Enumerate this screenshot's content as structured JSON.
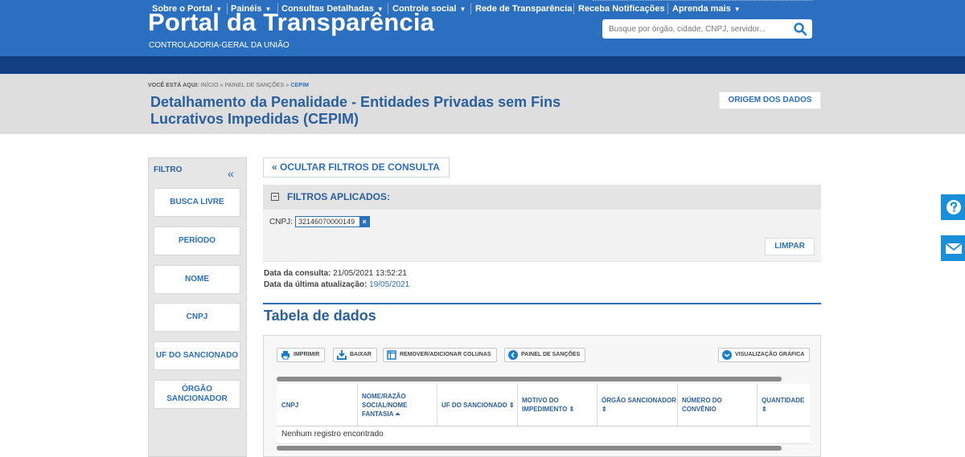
{
  "header": {
    "title": "Portal da Transparência",
    "subtitle": "CONTROLADORIA-GERAL DA UNIÃO",
    "search_placeholder": "Busque por órgão, cidade, CNPJ, servidor..."
  },
  "nav": {
    "items": [
      {
        "label": "Sobre o Portal",
        "dropdown": true
      },
      {
        "label": "Painéis",
        "dropdown": true
      },
      {
        "label": "Consultas Detalhadas",
        "dropdown": true
      },
      {
        "label": "Controle social",
        "dropdown": true
      },
      {
        "label": "Rede de Transparência",
        "dropdown": false
      },
      {
        "label": "Receba Notificações",
        "dropdown": false
      },
      {
        "label": "Aprenda mais",
        "dropdown": true
      }
    ]
  },
  "breadcrumb": {
    "label": "VOCÊ ESTÁ AQUI:",
    "items": [
      "INÍCIO",
      "PAINEL DE SANÇÕES",
      "CEPIM"
    ],
    "separator": "»"
  },
  "page": {
    "title": "Detalhamento da Penalidade - Entidades Privadas sem Fins Lucrativos Impedidas (CEPIM)",
    "origem_label": "ORIGEM DOS DADOS"
  },
  "sidebar": {
    "title": "FILTRO",
    "collapse_icon": "double-chevron-left",
    "filters": [
      "BUSCA LIVRE",
      "PERÍODO",
      "NOME",
      "CNPJ",
      "UF DO SANCIONADO",
      "ÓRGÃO SANCIONADOR"
    ]
  },
  "filters": {
    "hide_label": "« OCULTAR FILTROS DE CONSULTA",
    "applied_title": "FILTROS APLICADOS:",
    "cnpj_label": "CNPJ:",
    "cnpj_value": "32146070000149",
    "clear_label": "LIMPAR"
  },
  "meta": {
    "consulta_label": "Data da consulta:",
    "consulta_value": "21/05/2021 13:52:21",
    "atualizacao_label": "Data da última atualização:",
    "atualizacao_value": "19/05/2021"
  },
  "table": {
    "title": "Tabela de dados",
    "toolbar": {
      "print": "IMPRIMIR",
      "download": "BAIXAR",
      "columns": "REMOVER/ADICIONAR COLUNAS",
      "panel": "PAINEL DE SANÇÕES",
      "chart": "VISUALIZAÇÃO GRÁFICA"
    },
    "columns": [
      "CNPJ",
      "NOME/RAZÃO SOCIAL/NOME FANTASIA ⏶",
      "UF DO SANCIONADO ⇕",
      "MOTIVO DO IMPEDIMENTO ⇕",
      "ÓRGÃO SANCIONADOR ⇕",
      "NÚMERO DO CONVÊNIO",
      "QUANTIDADE ⇕"
    ],
    "empty_message": "Nenhum registro encontrado"
  },
  "colors": {
    "header_blue": "#2a6fc0",
    "nav_dark_blue": "#123f82",
    "accent_light_blue": "#1a8fd9",
    "band_gray": "#dedede"
  }
}
